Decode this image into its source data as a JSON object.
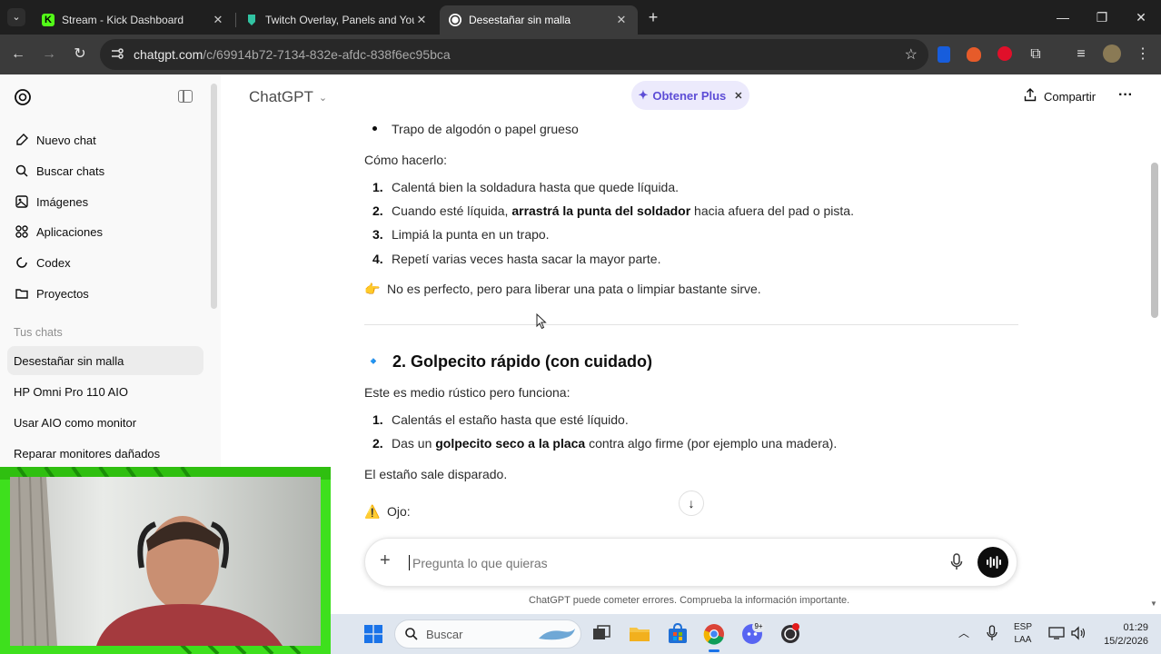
{
  "browser": {
    "tabs": [
      {
        "title": "Stream - Kick Dashboard",
        "icon": "kick-icon"
      },
      {
        "title": "Twitch Overlay, Panels and You",
        "icon": "streamlabs-icon"
      },
      {
        "title": "Desestañar sin malla",
        "icon": "chatgpt-icon"
      }
    ],
    "url_host": "chatgpt.com",
    "url_path": "/c/69914b72-7134-832e-afdc-838f6ec95bca"
  },
  "sidebar": {
    "actions": [
      {
        "label": "Nuevo chat",
        "icon": "new-chat-icon"
      },
      {
        "label": "Buscar chats",
        "icon": "search-icon"
      },
      {
        "label": "Imágenes",
        "icon": "image-icon"
      },
      {
        "label": "Aplicaciones",
        "icon": "apps-icon"
      },
      {
        "label": "Codex",
        "icon": "codex-icon"
      },
      {
        "label": "Proyectos",
        "icon": "folder-icon"
      }
    ],
    "section_title": "Tus chats",
    "chats": [
      {
        "label": "Desestañar sin malla"
      },
      {
        "label": "HP Omni Pro 110 AIO"
      },
      {
        "label": "Usar AIO como monitor"
      },
      {
        "label": "Reparar monitores dañados"
      }
    ]
  },
  "header": {
    "model": "ChatGPT",
    "upgrade": "Obtener Plus",
    "share": "Compartir"
  },
  "conversation": {
    "bullet_item": "Trapo de algodón o papel grueso",
    "how_to_label": "Cómo hacerlo:",
    "steps_1": [
      {
        "n": "1.",
        "before": "Calentá bien la soldadura hasta que quede líquida.",
        "bold": "",
        "after": ""
      },
      {
        "n": "2.",
        "before": "Cuando esté líquida, ",
        "bold": "arrastrá la punta del soldador",
        "after": " hacia afuera del pad o pista."
      },
      {
        "n": "3.",
        "before": "Limpiá la punta en un trapo.",
        "bold": "",
        "after": ""
      },
      {
        "n": "4.",
        "before": "Repetí varias veces hasta sacar la mayor parte.",
        "bold": "",
        "after": ""
      }
    ],
    "tip_emoji": "👉",
    "tip": "No es perfecto, pero para liberar una pata o limpiar bastante sirve.",
    "section2_emoji": "🔹",
    "section2_title": "2. Golpecito rápido (con cuidado)",
    "section2_intro": "Este es medio rústico pero funciona:",
    "steps_2": [
      {
        "n": "1.",
        "before": "Calentás el estaño hasta que esté líquido.",
        "bold": "",
        "after": ""
      },
      {
        "n": "2.",
        "before": "Das un ",
        "bold": "golpecito seco a la placa",
        "after": " contra algo firme (por ejemplo una madera)."
      }
    ],
    "result": "El estaño sale disparado.",
    "warning_emoji": "⚠️",
    "warning": "Ojo:"
  },
  "composer": {
    "placeholder": "Pregunta lo que quieras",
    "disclaimer": "ChatGPT puede cometer errores. Comprueba la información importante."
  },
  "taskbar": {
    "search_placeholder": "Buscar",
    "lang_1": "ESP",
    "lang_2": "LAA",
    "time": "01:29",
    "date": "15/2/2026",
    "badge": "9+"
  },
  "colors": {
    "kick_green": "#53fc18",
    "webcam_frame": "#3ee01d",
    "plus_purple": "#5d4dd6",
    "taskbar": "#dfe6ef"
  }
}
